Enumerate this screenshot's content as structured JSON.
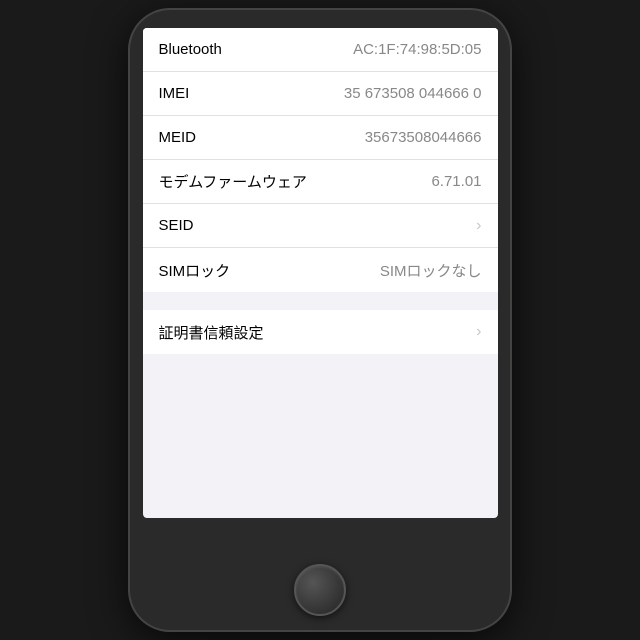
{
  "screen": {
    "rows": [
      {
        "id": "bluetooth",
        "label": "Bluetooth",
        "value": "AC:1F:74:98:5D:05",
        "hasChevron": false
      },
      {
        "id": "imei",
        "label": "IMEI",
        "value": "35 673508 044666 0",
        "hasChevron": false
      },
      {
        "id": "meid",
        "label": "MEID",
        "value": "35673508044666",
        "hasChevron": false
      },
      {
        "id": "modem",
        "label": "モデムファームウェア",
        "value": "6.71.01",
        "hasChevron": false
      },
      {
        "id": "seid",
        "label": "SEID",
        "value": "",
        "hasChevron": true
      },
      {
        "id": "sim-lock",
        "label": "SIMロック",
        "value": "SIMロックなし",
        "hasChevron": false
      }
    ],
    "cert_row": {
      "label": "証明書信頼設定",
      "hasChevron": true
    }
  }
}
